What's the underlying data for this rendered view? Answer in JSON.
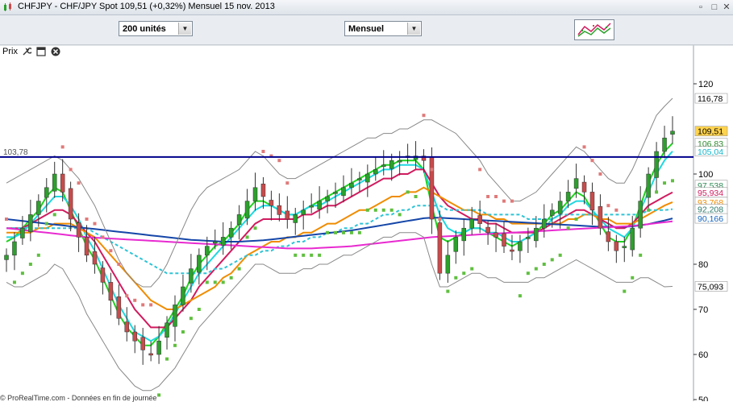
{
  "title_bar": {
    "title": "CHFJPY - CHF/JPY Spot    109,51 (+0,32%)    Mensuel  15 nov. 2013"
  },
  "toolbar": {
    "units_select": "200 unités",
    "period_select": "Mensuel"
  },
  "panel": {
    "label": "Prix"
  },
  "status_bar": {
    "text": "© ProRealTime.com - Données en fin de journée"
  },
  "chart_data": {
    "type": "line",
    "ylim": [
      50,
      125
    ],
    "y_ticks": [
      120,
      100,
      80,
      70,
      60,
      50
    ],
    "candle_colors": {
      "up": "#2ca02c",
      "down": "#c84b4b"
    },
    "reference_line": {
      "value": 103.78,
      "label": "103,78",
      "color": "#00008b"
    },
    "right_labels": [
      {
        "text": "116,78",
        "value": 116.78,
        "color": "#000000",
        "bg": "#ffffff"
      },
      {
        "text": "109,51",
        "value": 109.51,
        "color": "#000000",
        "bg": "#ffd34d"
      },
      {
        "text": "106,83",
        "value": 106.83,
        "color": "#2e8b2e",
        "bg": "#ffffff"
      },
      {
        "text": "105,04",
        "value": 105.04,
        "color": "#13b5c9",
        "bg": "#ffffff"
      },
      {
        "text": "97,538",
        "value": 97.538,
        "color": "#2e8b57",
        "bg": "#ffffff"
      },
      {
        "text": "95,934",
        "value": 95.934,
        "color": "#d11b5e",
        "bg": "#ffffff"
      },
      {
        "text": "93,768",
        "value": 93.768,
        "color": "#f08c00",
        "bg": "#ffffff"
      },
      {
        "text": "92,208",
        "value": 92.208,
        "color": "#2c7a6a",
        "bg": "#ffffff"
      },
      {
        "text": "90,166",
        "value": 90.166,
        "color": "#1565c0",
        "bg": "#ffffff"
      },
      {
        "text": "75,093",
        "value": 75.093,
        "color": "#000000",
        "bg": "#ffffff"
      }
    ],
    "price_series": [
      82,
      85,
      88,
      91,
      94,
      97,
      100,
      96,
      90,
      86,
      82,
      80,
      76,
      72,
      68,
      65,
      63,
      61,
      60,
      63,
      67,
      71,
      75,
      79,
      82,
      84,
      85,
      86,
      88,
      91,
      94,
      97,
      95,
      93,
      91,
      90,
      91,
      92,
      93,
      94,
      95,
      96,
      97,
      98,
      99,
      100,
      101,
      102,
      103,
      103,
      104,
      104,
      103,
      90,
      78,
      82,
      86,
      88,
      90,
      89,
      87,
      86,
      84,
      83,
      85,
      86,
      88,
      90,
      92,
      94,
      96,
      99,
      96,
      92,
      88,
      85,
      83,
      84,
      88,
      94,
      100,
      105,
      108,
      109.51
    ],
    "series": [
      {
        "key": "ma_fast",
        "color": "#1fd31f",
        "values": [
          85,
          86,
          88,
          90,
          92,
          95,
          97,
          96,
          92,
          88,
          84,
          81,
          77,
          73,
          69,
          66,
          64,
          62,
          62,
          64,
          67,
          70,
          73,
          77,
          80,
          82,
          84,
          85,
          87,
          89,
          92,
          94,
          94,
          93,
          92,
          91,
          91,
          92,
          93,
          94,
          95,
          96,
          97,
          98,
          99,
          100,
          101,
          102,
          102,
          103,
          103,
          103,
          101,
          93,
          86,
          85,
          86,
          87,
          88,
          88,
          87,
          86,
          85,
          84,
          85,
          86,
          87,
          89,
          91,
          92,
          94,
          96,
          95,
          92,
          89,
          86,
          85,
          85,
          88,
          93,
          98,
          102,
          105,
          106.83
        ]
      },
      {
        "key": "ma_cyan",
        "color": "#20d7e0",
        "values": [
          86,
          86,
          87,
          89,
          91,
          93,
          95,
          95,
          93,
          90,
          86,
          83,
          79,
          75,
          71,
          68,
          65,
          64,
          63,
          64,
          66,
          69,
          72,
          75,
          78,
          80,
          82,
          84,
          86,
          88,
          90,
          92,
          93,
          93,
          92,
          91,
          91,
          92,
          93,
          93,
          94,
          95,
          96,
          97,
          98,
          99,
          100,
          101,
          101,
          102,
          102,
          102,
          101,
          96,
          91,
          88,
          87,
          87,
          88,
          88,
          87,
          87,
          86,
          85,
          85,
          86,
          87,
          88,
          90,
          91,
          93,
          94,
          94,
          92,
          90,
          88,
          87,
          86,
          88,
          92,
          96,
          100,
          103,
          105.04
        ]
      },
      {
        "key": "ma_red",
        "color": "#d11b5e",
        "values": [
          88,
          88,
          88,
          89,
          90,
          91,
          92,
          92,
          91,
          89,
          87,
          85,
          82,
          79,
          76,
          73,
          70,
          68,
          66,
          66,
          66,
          68,
          70,
          72,
          75,
          77,
          79,
          81,
          83,
          85,
          87,
          89,
          90,
          90,
          90,
          90,
          90,
          91,
          91,
          92,
          93,
          93,
          94,
          95,
          96,
          97,
          98,
          99,
          99,
          100,
          100,
          101,
          101,
          98,
          95,
          93,
          92,
          91,
          90,
          90,
          89,
          89,
          88,
          87,
          87,
          87,
          87,
          88,
          89,
          90,
          91,
          92,
          92,
          91,
          90,
          89,
          88,
          88,
          89,
          91,
          93,
          94,
          95,
          95.934
        ]
      },
      {
        "key": "ma_orange",
        "color": "#f08c00",
        "values": [
          87,
          87,
          87,
          87,
          88,
          88,
          89,
          89,
          89,
          88,
          87,
          86,
          84,
          82,
          80,
          78,
          76,
          74,
          72,
          71,
          70,
          70,
          71,
          72,
          73,
          74,
          75,
          77,
          78,
          80,
          82,
          83,
          84,
          85,
          85,
          86,
          86,
          87,
          87,
          88,
          89,
          89,
          90,
          91,
          92,
          92,
          93,
          94,
          95,
          95,
          96,
          96,
          97,
          96,
          95,
          94,
          93,
          92,
          92,
          91,
          91,
          90,
          90,
          89,
          89,
          89,
          89,
          89,
          89,
          89,
          90,
          90,
          91,
          91,
          90,
          90,
          89,
          89,
          89,
          90,
          91,
          92,
          93,
          93.768
        ]
      },
      {
        "key": "ma_teal_dashed",
        "color": "#2ec4d6",
        "dashed": true,
        "values": [
          88,
          88,
          88,
          88,
          88,
          88,
          88,
          88,
          88,
          88,
          88,
          87,
          86,
          85,
          84,
          83,
          82,
          81,
          80,
          79,
          78,
          78,
          78,
          78,
          78,
          78,
          79,
          79,
          80,
          81,
          82,
          82,
          83,
          83,
          84,
          84,
          85,
          85,
          86,
          86,
          87,
          87,
          88,
          88,
          89,
          89,
          90,
          91,
          91,
          92,
          92,
          93,
          93,
          93,
          93,
          92,
          92,
          92,
          92,
          92,
          91,
          91,
          91,
          91,
          91,
          90,
          90,
          90,
          90,
          91,
          91,
          91,
          91,
          91,
          91,
          91,
          91,
          91,
          91,
          91,
          92,
          92,
          92,
          92.208
        ]
      },
      {
        "key": "ma_blue",
        "color": "#1546a8",
        "values": [
          90,
          89.8,
          89.6,
          89.4,
          89.2,
          89,
          88.8,
          88.6,
          88.4,
          88.2,
          88,
          87.8,
          87.6,
          87.4,
          87.2,
          87,
          86.8,
          86.6,
          86.4,
          86.2,
          86,
          85.8,
          85.6,
          85.4,
          85.3,
          85.2,
          85.1,
          85,
          85,
          85,
          85.1,
          85.2,
          85.3,
          85.5,
          85.7,
          85.9,
          86.1,
          86.3,
          86.5,
          86.7,
          86.9,
          87.1,
          87.3,
          87.5,
          87.8,
          88.1,
          88.4,
          88.7,
          89,
          89.3,
          89.6,
          89.9,
          90.2,
          90.3,
          90.3,
          90.2,
          90.1,
          90,
          89.9,
          89.8,
          89.7,
          89.6,
          89.5,
          89.4,
          89.3,
          89.2,
          89.1,
          89,
          88.9,
          88.8,
          88.7,
          88.6,
          88.5,
          88.4,
          88.3,
          88.3,
          88.3,
          88.3,
          88.4,
          88.6,
          88.9,
          89.3,
          89.7,
          90.166
        ]
      },
      {
        "key": "ma_magenta",
        "color": "#e82ad0",
        "values": [
          88,
          87.8,
          87.6,
          87.4,
          87.2,
          87,
          86.8,
          86.6,
          86.4,
          86.2,
          86,
          85.9,
          85.8,
          85.7,
          85.6,
          85.5,
          85.4,
          85.3,
          85.2,
          85.1,
          85,
          84.9,
          84.8,
          84.7,
          84.6,
          84.5,
          84.4,
          84.3,
          84.2,
          84.1,
          84,
          83.9,
          83.8,
          83.7,
          83.6,
          83.5,
          83.5,
          83.5,
          83.5,
          83.6,
          83.7,
          83.8,
          83.9,
          84,
          84.2,
          84.4,
          84.6,
          84.8,
          85,
          85.2,
          85.4,
          85.6,
          85.8,
          86,
          86.1,
          86.2,
          86.3,
          86.4,
          86.5,
          86.6,
          86.7,
          86.8,
          86.9,
          87,
          87.1,
          87.2,
          87.3,
          87.4,
          87.5,
          87.6,
          87.7,
          87.8,
          87.9,
          88,
          88.1,
          88.2,
          88.3,
          88.4,
          88.5,
          88.7,
          88.9,
          89.1,
          89.3,
          89.5
        ]
      },
      {
        "key": "bb_upper",
        "color": "#888888",
        "values": [
          98,
          99,
          100,
          101,
          102,
          103,
          104,
          103,
          101,
          99,
          96,
          93,
          89,
          85,
          81,
          78,
          76,
          75,
          75,
          77,
          80,
          84,
          88,
          92,
          95,
          97,
          98,
          99,
          100,
          101,
          103,
          105,
          104,
          102,
          100,
          99,
          99,
          100,
          101,
          102,
          103,
          104,
          105,
          106,
          107,
          108,
          108,
          109,
          109,
          110,
          110,
          111,
          112,
          112,
          111,
          110,
          109,
          107,
          105,
          103,
          100,
          98,
          96,
          94,
          94,
          95,
          96,
          98,
          100,
          102,
          104,
          106,
          105,
          103,
          101,
          99,
          98,
          98,
          101,
          105,
          109,
          113,
          115,
          116.78
        ]
      },
      {
        "key": "bb_lower",
        "color": "#888888",
        "values": [
          76,
          75,
          75,
          76,
          77,
          78,
          80,
          79,
          76,
          73,
          69,
          66,
          63,
          60,
          57,
          55,
          53,
          52,
          52,
          53,
          55,
          57,
          60,
          63,
          66,
          68,
          70,
          72,
          74,
          76,
          78,
          80,
          80,
          79,
          78,
          78,
          78,
          79,
          79,
          80,
          80,
          81,
          82,
          82,
          83,
          84,
          85,
          86,
          86,
          87,
          87,
          87,
          86,
          80,
          75,
          75,
          76,
          77,
          78,
          78,
          77,
          77,
          76,
          76,
          76,
          76,
          77,
          77,
          78,
          79,
          80,
          81,
          80,
          79,
          78,
          77,
          76,
          76,
          76,
          77,
          77,
          76,
          75,
          75.093
        ]
      }
    ]
  }
}
